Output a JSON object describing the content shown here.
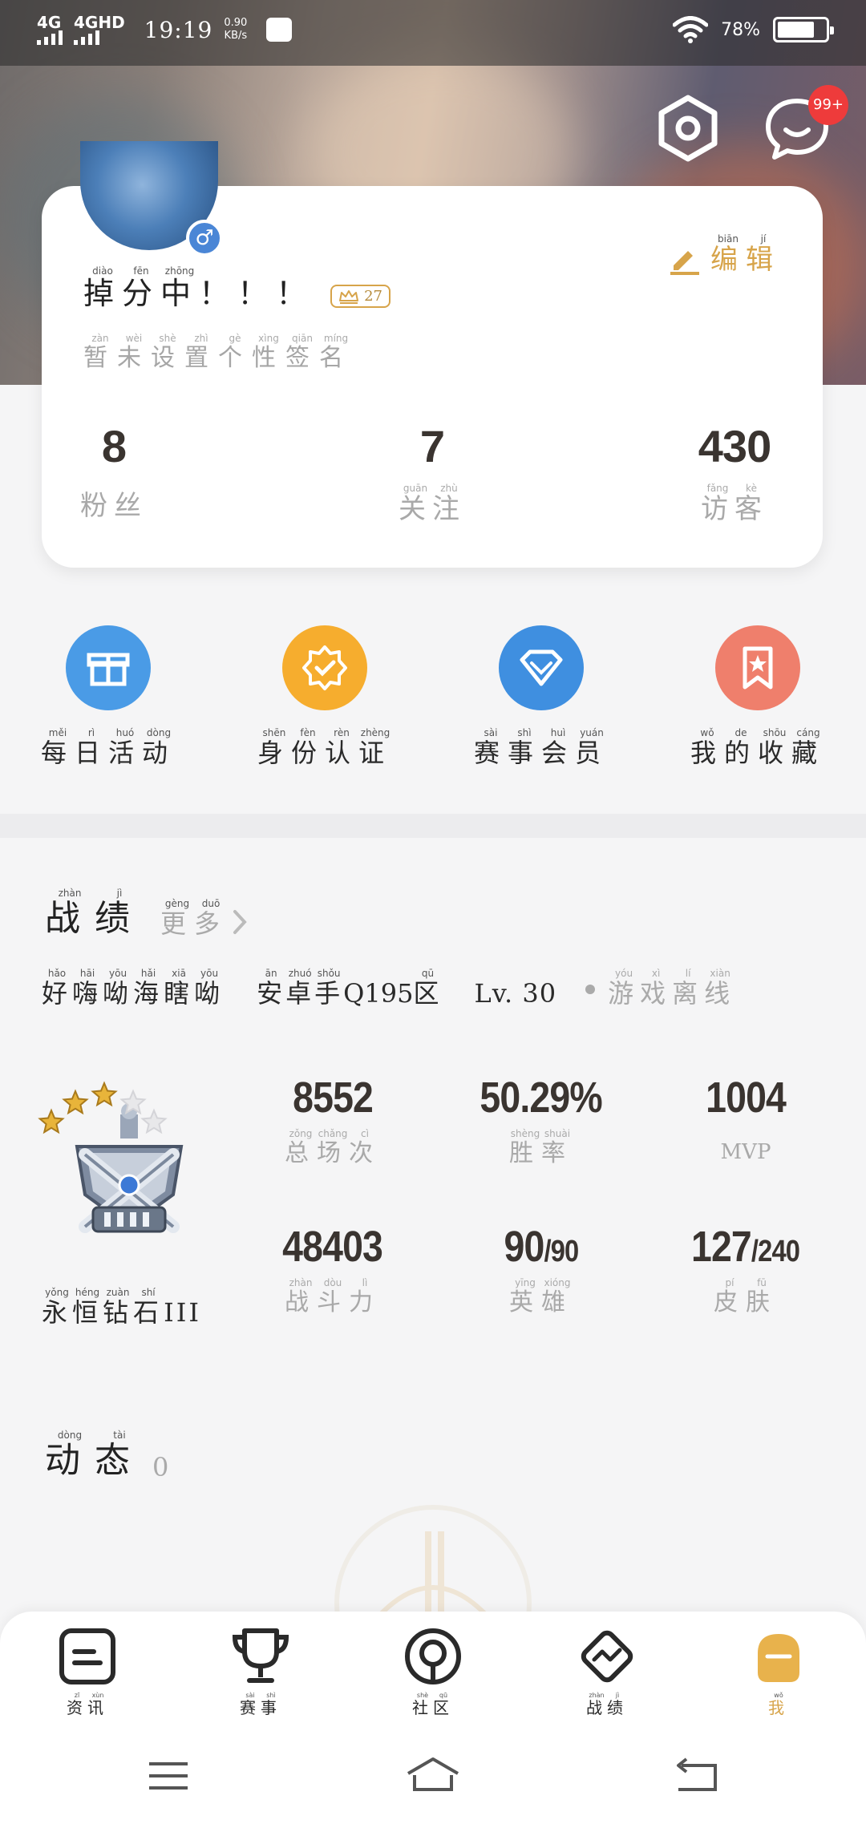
{
  "status_bar": {
    "signal1": "4G",
    "signal2": "4GHD",
    "time": "19:19",
    "speed_value": "0.90",
    "speed_unit": "KB/s",
    "battery_percent": "78%",
    "battery_level": 0.78
  },
  "header": {
    "settings_icon": "hexagon-settings-icon",
    "message_icon": "chat-icon",
    "message_badge": "99+"
  },
  "profile": {
    "gender_symbol": "♂",
    "edit_label": "编辑",
    "edit_pinyin": [
      "biān",
      "jí"
    ],
    "nickname_chars": [
      "掉",
      "分",
      "中",
      "！",
      "！",
      "！"
    ],
    "nickname_pinyin": [
      "diào",
      "fēn",
      "zhōng",
      "",
      "",
      ""
    ],
    "level": "27",
    "signature_chars": [
      "暂",
      "未",
      "设",
      "置",
      "个",
      "性",
      "签",
      "名"
    ],
    "signature_pinyin": [
      "zàn",
      "wèi",
      "shè",
      "zhì",
      "gè",
      "xìng",
      "qiān",
      "míng"
    ],
    "stats": [
      {
        "value": "8",
        "label_chars": [
          "粉",
          "丝"
        ],
        "label_pinyin": [
          "",
          ""
        ]
      },
      {
        "value": "7",
        "label_chars": [
          "关",
          "注"
        ],
        "label_pinyin": [
          "guān",
          "zhù"
        ]
      },
      {
        "value": "430",
        "label_chars": [
          "访",
          "客"
        ],
        "label_pinyin": [
          "fǎng",
          "kè"
        ]
      }
    ]
  },
  "actions": [
    {
      "chars": [
        "每",
        "日",
        "活",
        "动"
      ],
      "pinyin": [
        "měi",
        "rì",
        "huó",
        "dòng"
      ],
      "color": "#4a9be6",
      "icon": "gift-icon"
    },
    {
      "chars": [
        "身",
        "份",
        "认",
        "证"
      ],
      "pinyin": [
        "shēn",
        "fèn",
        "rèn",
        "zhèng"
      ],
      "color": "#f6ad2e",
      "icon": "verified-badge-icon"
    },
    {
      "chars": [
        "赛",
        "事",
        "会",
        "员"
      ],
      "pinyin": [
        "sài",
        "shì",
        "huì",
        "yuán"
      ],
      "color": "#3f8fe0",
      "icon": "diamond-icon"
    },
    {
      "chars": [
        "我",
        "的",
        "收",
        "藏"
      ],
      "pinyin": [
        "wǒ",
        "de",
        "shōu",
        "cáng"
      ],
      "color": "#ef7f6c",
      "icon": "bookmark-star-icon"
    }
  ],
  "record": {
    "title_chars": [
      "战",
      "绩"
    ],
    "title_pinyin": [
      "zhàn",
      "jì"
    ],
    "more_chars": [
      "更",
      "多"
    ],
    "more_pinyin": [
      "gèng",
      "duō"
    ],
    "player_name_chars": [
      "好",
      "嗨",
      "呦",
      "海",
      "瞎",
      "呦"
    ],
    "player_name_pinyin": [
      "hǎo",
      "hāi",
      "yōu",
      "hǎi",
      "xiā",
      "yōu"
    ],
    "server_chars": [
      "安",
      "卓",
      "手",
      "Q195",
      "区"
    ],
    "server_pinyin": [
      "ān",
      "zhuó",
      "shǒu",
      "",
      "qū"
    ],
    "level": "Lv. 30",
    "status_chars": [
      "游",
      "戏",
      "离",
      "线"
    ],
    "status_pinyin": [
      "yóu",
      "xì",
      "lí",
      "xiàn"
    ],
    "rank_chars": [
      "永",
      "恒",
      "钻",
      "石",
      "III"
    ],
    "rank_pinyin": [
      "yǒng",
      "héng",
      "zuàn",
      "shí",
      ""
    ],
    "rank_stars": 3,
    "rank_stars_total": 5,
    "stats_row1": [
      {
        "value": "8552",
        "label_chars": [
          "总",
          "场",
          "次"
        ],
        "label_pinyin": [
          "zǒng",
          "chǎng",
          "cì"
        ]
      },
      {
        "value": "50.29%",
        "label_chars": [
          "胜",
          "率"
        ],
        "label_pinyin": [
          "shèng",
          "shuài"
        ]
      },
      {
        "value": "1004",
        "label_chars": [
          "MVP"
        ],
        "label_pinyin": [
          ""
        ]
      }
    ],
    "stats_row2": [
      {
        "value": "48403",
        "suffix": "",
        "label_chars": [
          "战",
          "斗",
          "力"
        ],
        "label_pinyin": [
          "zhàn",
          "dòu",
          "lì"
        ]
      },
      {
        "value": "90",
        "suffix": "/90",
        "label_chars": [
          "英",
          "雄"
        ],
        "label_pinyin": [
          "yīng",
          "xióng"
        ]
      },
      {
        "value": "127",
        "suffix": "/240",
        "label_chars": [
          "皮",
          "肤"
        ],
        "label_pinyin": [
          "pí",
          "fū"
        ]
      }
    ]
  },
  "dynamics": {
    "title_chars": [
      "动",
      "态"
    ],
    "title_pinyin": [
      "dòng",
      "tài"
    ],
    "count": "0"
  },
  "tabs": [
    {
      "chars": [
        "资",
        "讯"
      ],
      "pinyin": [
        "zī",
        "xùn"
      ],
      "icon": "news-icon",
      "active": false
    },
    {
      "chars": [
        "赛",
        "事"
      ],
      "pinyin": [
        "sài",
        "shì"
      ],
      "icon": "trophy-icon",
      "active": false
    },
    {
      "chars": [
        "社",
        "区"
      ],
      "pinyin": [
        "shè",
        "qū"
      ],
      "icon": "community-icon",
      "active": false
    },
    {
      "chars": [
        "战",
        "绩"
      ],
      "pinyin": [
        "zhàn",
        "jì"
      ],
      "icon": "record-icon",
      "active": false
    },
    {
      "chars": [
        "我"
      ],
      "pinyin": [
        "wǒ"
      ],
      "icon": "profile-icon",
      "active": true
    }
  ],
  "colors": {
    "accent_gold": "#d7a44a",
    "text_dark": "#2a2a2a",
    "text_grey": "#a9a9a9",
    "badge_red": "#ee3b3b"
  }
}
